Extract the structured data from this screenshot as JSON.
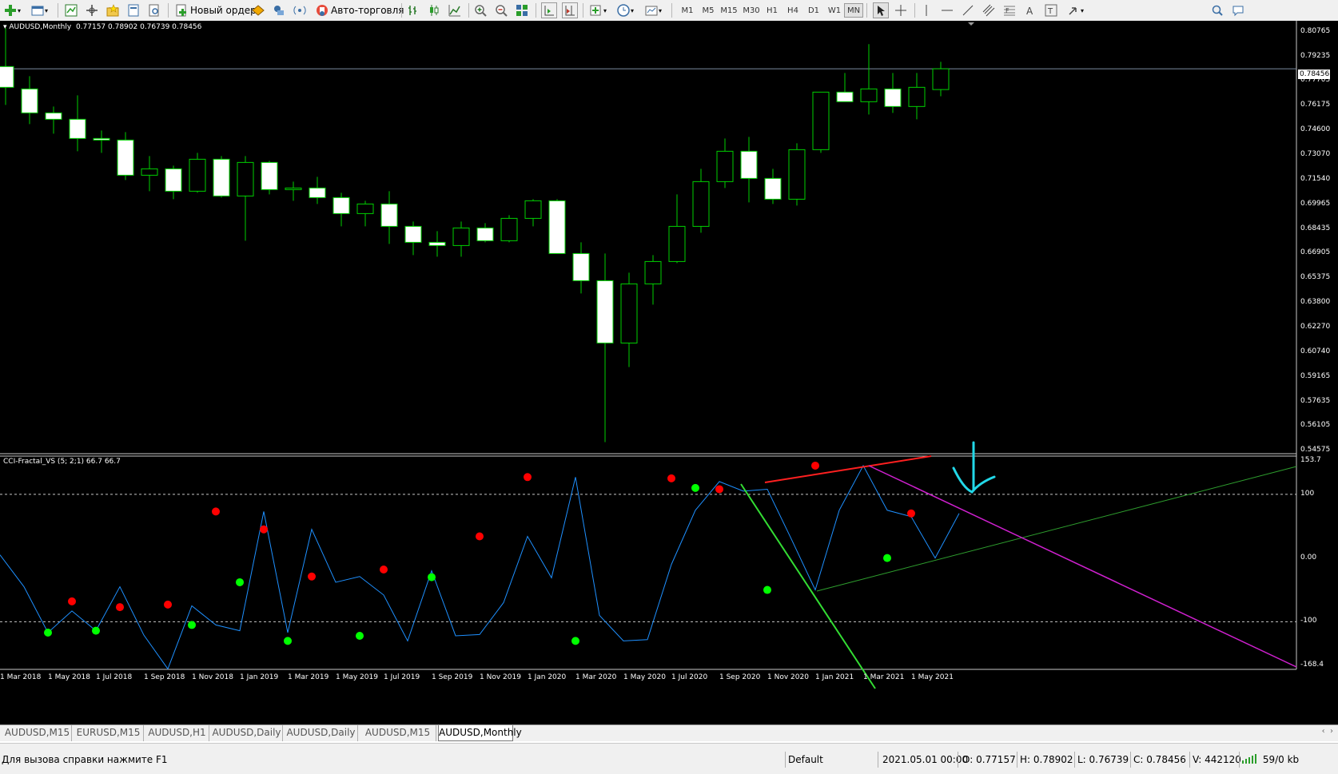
{
  "toolbar": {
    "new_order_label": "Новый ордер",
    "autotrading_label": "Авто-торговля",
    "timeframes": [
      "M1",
      "M5",
      "M15",
      "M30",
      "H1",
      "H4",
      "D1",
      "W1",
      "MN"
    ],
    "active_timeframe": "MN"
  },
  "chart": {
    "title": "AUDUSD,Monthly",
    "ohlc": "0.77157 0.78902 0.76739 0.78456",
    "current_price": "0.78456",
    "price_labels": [
      "0.80765",
      "0.79235",
      "0.77705",
      "0.76175",
      "0.74600",
      "0.73070",
      "0.71540",
      "0.69965",
      "0.68435",
      "0.66905",
      "0.65375",
      "0.63800",
      "0.62270",
      "0.60740",
      "0.59165",
      "0.57635",
      "0.56105",
      "0.54575"
    ],
    "bull_color": "#00d000",
    "bear_color": "#ffffff"
  },
  "indicator": {
    "title": "CCI-Fractal_VS (5; 2;1) 66.7 66.7",
    "levels": [
      "153.7",
      "100",
      "0.00",
      "-100",
      "-168.4"
    ],
    "line_color": "#1e90ff",
    "up_fractal_color": "#ff0000",
    "down_fractal_color": "#00ff00"
  },
  "dates": [
    "1 Mar 2018",
    "1 May 2018",
    "1 Jul 2018",
    "1 Sep 2018",
    "1 Nov 2018",
    "1 Jan 2019",
    "1 Mar 2019",
    "1 May 2019",
    "1 Jul 2019",
    "1 Sep 2019",
    "1 Nov 2019",
    "1 Jan 2020",
    "1 Mar 2020",
    "1 May 2020",
    "1 Jul 2020",
    "1 Sep 2020",
    "1 Nov 2020",
    "1 Jan 2021",
    "1 Mar 2021",
    "1 May 2021"
  ],
  "chart_data": {
    "type": "candlestick",
    "symbol": "AUDUSD",
    "timeframe": "Monthly",
    "candles": [
      {
        "o": 0.786,
        "h": 0.81,
        "l": 0.762,
        "c": 0.773
      },
      {
        "o": 0.772,
        "h": 0.78,
        "l": 0.75,
        "c": 0.757
      },
      {
        "o": 0.757,
        "h": 0.761,
        "l": 0.744,
        "c": 0.753
      },
      {
        "o": 0.753,
        "h": 0.768,
        "l": 0.733,
        "c": 0.741
      },
      {
        "o": 0.741,
        "h": 0.746,
        "l": 0.732,
        "c": 0.74
      },
      {
        "o": 0.74,
        "h": 0.745,
        "l": 0.715,
        "c": 0.718
      },
      {
        "o": 0.718,
        "h": 0.73,
        "l": 0.708,
        "c": 0.722
      },
      {
        "o": 0.722,
        "h": 0.724,
        "l": 0.703,
        "c": 0.708
      },
      {
        "o": 0.708,
        "h": 0.732,
        "l": 0.707,
        "c": 0.728
      },
      {
        "o": 0.728,
        "h": 0.73,
        "l": 0.704,
        "c": 0.705
      },
      {
        "o": 0.705,
        "h": 0.73,
        "l": 0.677,
        "c": 0.726
      },
      {
        "o": 0.726,
        "h": 0.727,
        "l": 0.706,
        "c": 0.709
      },
      {
        "o": 0.709,
        "h": 0.714,
        "l": 0.702,
        "c": 0.71
      },
      {
        "o": 0.71,
        "h": 0.717,
        "l": 0.7,
        "c": 0.704
      },
      {
        "o": 0.704,
        "h": 0.707,
        "l": 0.686,
        "c": 0.694
      },
      {
        "o": 0.694,
        "h": 0.702,
        "l": 0.686,
        "c": 0.7
      },
      {
        "o": 0.7,
        "h": 0.708,
        "l": 0.675,
        "c": 0.686
      },
      {
        "o": 0.686,
        "h": 0.689,
        "l": 0.668,
        "c": 0.676
      },
      {
        "o": 0.676,
        "h": 0.683,
        "l": 0.667,
        "c": 0.674
      },
      {
        "o": 0.674,
        "h": 0.689,
        "l": 0.667,
        "c": 0.685
      },
      {
        "o": 0.685,
        "h": 0.688,
        "l": 0.676,
        "c": 0.677
      },
      {
        "o": 0.677,
        "h": 0.693,
        "l": 0.676,
        "c": 0.691
      },
      {
        "o": 0.691,
        "h": 0.703,
        "l": 0.686,
        "c": 0.702
      },
      {
        "o": 0.702,
        "h": 0.703,
        "l": 0.669,
        "c": 0.669
      },
      {
        "o": 0.669,
        "h": 0.676,
        "l": 0.644,
        "c": 0.652
      },
      {
        "o": 0.652,
        "h": 0.669,
        "l": 0.551,
        "c": 0.613
      },
      {
        "o": 0.613,
        "h": 0.657,
        "l": 0.598,
        "c": 0.65
      },
      {
        "o": 0.65,
        "h": 0.668,
        "l": 0.637,
        "c": 0.664
      },
      {
        "o": 0.664,
        "h": 0.706,
        "l": 0.663,
        "c": 0.686
      },
      {
        "o": 0.686,
        "h": 0.722,
        "l": 0.682,
        "c": 0.714
      },
      {
        "o": 0.714,
        "h": 0.741,
        "l": 0.71,
        "c": 0.733
      },
      {
        "o": 0.733,
        "h": 0.742,
        "l": 0.701,
        "c": 0.716
      },
      {
        "o": 0.716,
        "h": 0.722,
        "l": 0.7,
        "c": 0.703
      },
      {
        "o": 0.703,
        "h": 0.738,
        "l": 0.699,
        "c": 0.734
      },
      {
        "o": 0.734,
        "h": 0.764,
        "l": 0.732,
        "c": 0.77
      },
      {
        "o": 0.77,
        "h": 0.782,
        "l": 0.764,
        "c": 0.764
      },
      {
        "o": 0.764,
        "h": 0.8,
        "l": 0.756,
        "c": 0.772
      },
      {
        "o": 0.772,
        "h": 0.782,
        "l": 0.757,
        "c": 0.761
      },
      {
        "o": 0.761,
        "h": 0.782,
        "l": 0.753,
        "c": 0.773
      },
      {
        "o": 0.7716,
        "h": 0.789,
        "l": 0.7674,
        "c": 0.7846
      }
    ],
    "ylim": [
      0.54575,
      0.80765
    ],
    "indicator_series": {
      "name": "CCI-Fractal_VS",
      "values": [
        5,
        -45,
        -117,
        -83,
        -114,
        -45,
        -121,
        -174,
        -75,
        -105,
        -114,
        73,
        -117,
        45,
        -38,
        -29,
        -58,
        -130,
        -20,
        -122,
        -120,
        -70,
        34,
        -31,
        127,
        -90,
        -130,
        -128,
        -10,
        75,
        120,
        105,
        108,
        30,
        -50,
        75,
        145,
        75,
        65,
        0,
        70
      ],
      "up_fractals": [
        {
          "i": 3,
          "v": -68
        },
        {
          "i": 5,
          "v": -77
        },
        {
          "i": 7,
          "v": -73
        },
        {
          "i": 9,
          "v": 73
        },
        {
          "i": 11,
          "v": 45
        },
        {
          "i": 13,
          "v": -29
        },
        {
          "i": 16,
          "v": -18
        },
        {
          "i": 20,
          "v": 34
        },
        {
          "i": 22,
          "v": 127
        },
        {
          "i": 28,
          "v": 125
        },
        {
          "i": 30,
          "v": 108
        },
        {
          "i": 34,
          "v": 145
        },
        {
          "i": 38,
          "v": 70
        }
      ],
      "down_fractals": [
        {
          "i": 2,
          "v": -117
        },
        {
          "i": 4,
          "v": -114
        },
        {
          "i": 8,
          "v": -105
        },
        {
          "i": 10,
          "v": -38
        },
        {
          "i": 12,
          "v": -130
        },
        {
          "i": 15,
          "v": -122
        },
        {
          "i": 18,
          "v": -30
        },
        {
          "i": 24,
          "v": -130
        },
        {
          "i": 29,
          "v": 110
        },
        {
          "i": 32,
          "v": -50
        },
        {
          "i": 37,
          "v": 0
        }
      ],
      "ylim": [
        -168.4,
        153.7
      ]
    }
  },
  "tabs": [
    {
      "label": "AUDUSD,M15"
    },
    {
      "label": "EURUSD,M15"
    },
    {
      "label": "AUDUSD,H1"
    },
    {
      "label": "AUDUSD,Daily"
    },
    {
      "label": "AUDUSD,Daily"
    },
    {
      "label": "AUDUSD,M15"
    },
    {
      "label": "AUDUSD,Monthly"
    }
  ],
  "status": {
    "help": "Для вызова справки нажмите F1",
    "profile": "Default",
    "datetime": "2021.05.01 00:00",
    "open": "O: 0.77157",
    "high": "H: 0.78902",
    "low": "L: 0.76739",
    "close": "C: 0.78456",
    "volume": "V: 442120",
    "traffic": "59/0 kb"
  }
}
